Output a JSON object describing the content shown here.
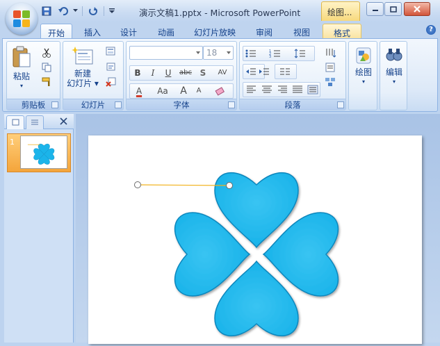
{
  "window": {
    "title": "演示文稿1.pptx - Microsoft PowerPoint",
    "context_tab": "绘图...",
    "minimize": "─",
    "maximize": "▢",
    "close": "✕"
  },
  "tabs": [
    "开始",
    "插入",
    "设计",
    "动画",
    "幻灯片放映",
    "审阅",
    "视图",
    "格式"
  ],
  "help": "?",
  "groups": {
    "clipboard": {
      "label": "剪贴板",
      "paste": "粘贴"
    },
    "slides": {
      "label": "幻灯片",
      "new_slide_line1": "新建",
      "new_slide_line2": "幻灯片 ▾"
    },
    "font": {
      "label": "字体",
      "font_name": "",
      "font_size": "18",
      "bold": "B",
      "italic": "I",
      "underline": "U",
      "strike": "abc",
      "shadow": "S",
      "spacing": "AV",
      "color": "A",
      "case": "Aa",
      "grow": "A",
      "shrink": "A"
    },
    "paragraph": {
      "label": "段落"
    },
    "drawing": {
      "label": "绘图"
    },
    "editing": {
      "label": "编辑"
    }
  },
  "slide_pane": {
    "slide_number": "1"
  },
  "colors": {
    "heart_fill": "#1bb4ea",
    "heart_stroke": "#0e86bc",
    "connector": "#f2b21c",
    "selection_thumb": "#f4a53b"
  }
}
